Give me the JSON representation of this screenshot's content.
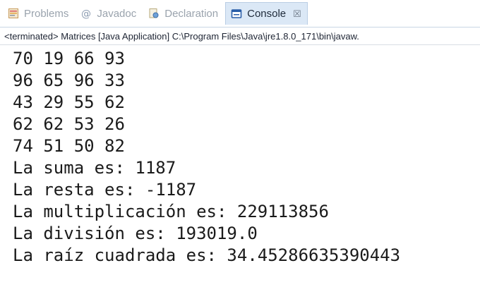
{
  "tabs": [
    {
      "label": "Problems",
      "icon": "problems-icon",
      "active": false
    },
    {
      "label": "Javadoc",
      "icon": "javadoc-icon",
      "active": false
    },
    {
      "label": "Declaration",
      "icon": "declaration-icon",
      "active": false
    },
    {
      "label": "Console",
      "icon": "console-icon",
      "active": true,
      "close": "☒"
    }
  ],
  "status_text": "<terminated> Matrices [Java Application] C:\\Program Files\\Java\\jre1.8.0_171\\bin\\javaw.",
  "console_lines": [
    "70 19 66 93",
    "96 65 96 33",
    "43 29 55 62",
    "62 62 53 26",
    "74 51 50 82",
    "La suma es: 1187",
    "La resta es: -1187",
    "La multiplicación es: 229113856",
    "La división es: 193019.0",
    "La raíz cuadrada es: 34.45286635390443"
  ],
  "colors": {
    "active_tab_bg": "#dbe8f6",
    "inactive_tab_text": "#9aa3ad"
  }
}
